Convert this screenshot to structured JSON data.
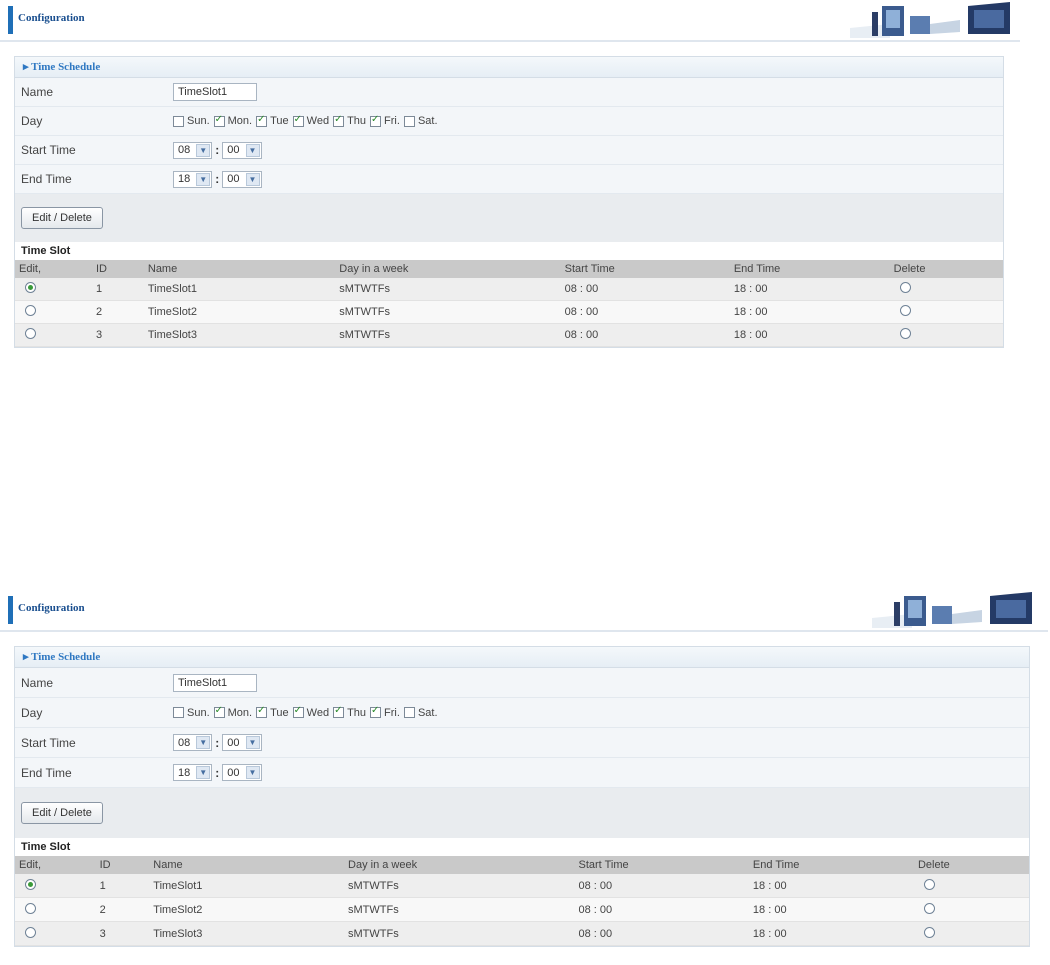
{
  "header": {
    "title": "Configuration"
  },
  "schedule": {
    "section_title": "Time Schedule",
    "name_label": "Name",
    "name_value": "TimeSlot1",
    "day_label": "Day",
    "days": [
      {
        "label": "Sun.",
        "checked": false
      },
      {
        "label": "Mon.",
        "checked": true
      },
      {
        "label": "Tue",
        "checked": true
      },
      {
        "label": "Wed",
        "checked": true
      },
      {
        "label": "Thu",
        "checked": true
      },
      {
        "label": "Fri.",
        "checked": true
      },
      {
        "label": "Sat.",
        "checked": false
      }
    ],
    "start_label": "Start Time",
    "start_hour": "08",
    "start_min": "00",
    "end_label": "End Time",
    "end_hour": "18",
    "end_min": "00",
    "colon": ":",
    "button_label": "Edit / Delete"
  },
  "slots": {
    "title": "Time Slot",
    "columns": [
      "Edit,",
      "ID",
      "Name",
      "Day in a week",
      "Start Time",
      "End Time",
      "Delete"
    ],
    "rows": [
      {
        "edit_selected": true,
        "id": "1",
        "name": "TimeSlot1",
        "days": "sMTWTFs",
        "start": "08 : 00",
        "end": "18 : 00"
      },
      {
        "edit_selected": false,
        "id": "2",
        "name": "TimeSlot2",
        "days": "sMTWTFs",
        "start": "08 : 00",
        "end": "18 : 00"
      },
      {
        "edit_selected": false,
        "id": "3",
        "name": "TimeSlot3",
        "days": "sMTWTFs",
        "start": "08 : 00",
        "end": "18 : 00"
      }
    ]
  }
}
